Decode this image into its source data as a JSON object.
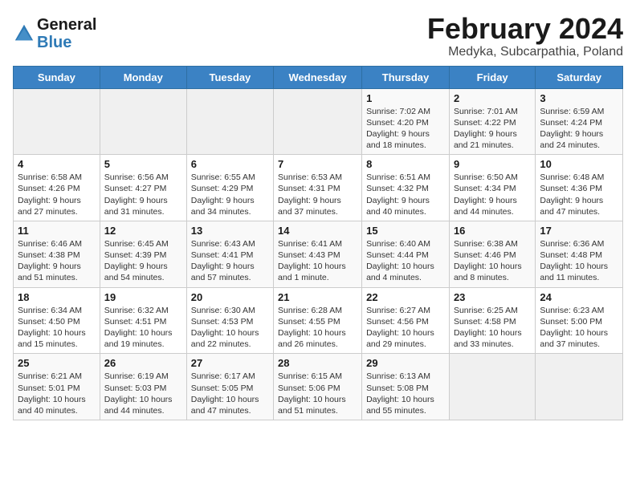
{
  "logo": {
    "text_general": "General",
    "text_blue": "Blue"
  },
  "title": "February 2024",
  "subtitle": "Medyka, Subcarpathia, Poland",
  "days_of_week": [
    "Sunday",
    "Monday",
    "Tuesday",
    "Wednesday",
    "Thursday",
    "Friday",
    "Saturday"
  ],
  "weeks": [
    [
      {
        "day": "",
        "info": ""
      },
      {
        "day": "",
        "info": ""
      },
      {
        "day": "",
        "info": ""
      },
      {
        "day": "",
        "info": ""
      },
      {
        "day": "1",
        "info": "Sunrise: 7:02 AM\nSunset: 4:20 PM\nDaylight: 9 hours\nand 18 minutes."
      },
      {
        "day": "2",
        "info": "Sunrise: 7:01 AM\nSunset: 4:22 PM\nDaylight: 9 hours\nand 21 minutes."
      },
      {
        "day": "3",
        "info": "Sunrise: 6:59 AM\nSunset: 4:24 PM\nDaylight: 9 hours\nand 24 minutes."
      }
    ],
    [
      {
        "day": "4",
        "info": "Sunrise: 6:58 AM\nSunset: 4:26 PM\nDaylight: 9 hours\nand 27 minutes."
      },
      {
        "day": "5",
        "info": "Sunrise: 6:56 AM\nSunset: 4:27 PM\nDaylight: 9 hours\nand 31 minutes."
      },
      {
        "day": "6",
        "info": "Sunrise: 6:55 AM\nSunset: 4:29 PM\nDaylight: 9 hours\nand 34 minutes."
      },
      {
        "day": "7",
        "info": "Sunrise: 6:53 AM\nSunset: 4:31 PM\nDaylight: 9 hours\nand 37 minutes."
      },
      {
        "day": "8",
        "info": "Sunrise: 6:51 AM\nSunset: 4:32 PM\nDaylight: 9 hours\nand 40 minutes."
      },
      {
        "day": "9",
        "info": "Sunrise: 6:50 AM\nSunset: 4:34 PM\nDaylight: 9 hours\nand 44 minutes."
      },
      {
        "day": "10",
        "info": "Sunrise: 6:48 AM\nSunset: 4:36 PM\nDaylight: 9 hours\nand 47 minutes."
      }
    ],
    [
      {
        "day": "11",
        "info": "Sunrise: 6:46 AM\nSunset: 4:38 PM\nDaylight: 9 hours\nand 51 minutes."
      },
      {
        "day": "12",
        "info": "Sunrise: 6:45 AM\nSunset: 4:39 PM\nDaylight: 9 hours\nand 54 minutes."
      },
      {
        "day": "13",
        "info": "Sunrise: 6:43 AM\nSunset: 4:41 PM\nDaylight: 9 hours\nand 57 minutes."
      },
      {
        "day": "14",
        "info": "Sunrise: 6:41 AM\nSunset: 4:43 PM\nDaylight: 10 hours\nand 1 minute."
      },
      {
        "day": "15",
        "info": "Sunrise: 6:40 AM\nSunset: 4:44 PM\nDaylight: 10 hours\nand 4 minutes."
      },
      {
        "day": "16",
        "info": "Sunrise: 6:38 AM\nSunset: 4:46 PM\nDaylight: 10 hours\nand 8 minutes."
      },
      {
        "day": "17",
        "info": "Sunrise: 6:36 AM\nSunset: 4:48 PM\nDaylight: 10 hours\nand 11 minutes."
      }
    ],
    [
      {
        "day": "18",
        "info": "Sunrise: 6:34 AM\nSunset: 4:50 PM\nDaylight: 10 hours\nand 15 minutes."
      },
      {
        "day": "19",
        "info": "Sunrise: 6:32 AM\nSunset: 4:51 PM\nDaylight: 10 hours\nand 19 minutes."
      },
      {
        "day": "20",
        "info": "Sunrise: 6:30 AM\nSunset: 4:53 PM\nDaylight: 10 hours\nand 22 minutes."
      },
      {
        "day": "21",
        "info": "Sunrise: 6:28 AM\nSunset: 4:55 PM\nDaylight: 10 hours\nand 26 minutes."
      },
      {
        "day": "22",
        "info": "Sunrise: 6:27 AM\nSunset: 4:56 PM\nDaylight: 10 hours\nand 29 minutes."
      },
      {
        "day": "23",
        "info": "Sunrise: 6:25 AM\nSunset: 4:58 PM\nDaylight: 10 hours\nand 33 minutes."
      },
      {
        "day": "24",
        "info": "Sunrise: 6:23 AM\nSunset: 5:00 PM\nDaylight: 10 hours\nand 37 minutes."
      }
    ],
    [
      {
        "day": "25",
        "info": "Sunrise: 6:21 AM\nSunset: 5:01 PM\nDaylight: 10 hours\nand 40 minutes."
      },
      {
        "day": "26",
        "info": "Sunrise: 6:19 AM\nSunset: 5:03 PM\nDaylight: 10 hours\nand 44 minutes."
      },
      {
        "day": "27",
        "info": "Sunrise: 6:17 AM\nSunset: 5:05 PM\nDaylight: 10 hours\nand 47 minutes."
      },
      {
        "day": "28",
        "info": "Sunrise: 6:15 AM\nSunset: 5:06 PM\nDaylight: 10 hours\nand 51 minutes."
      },
      {
        "day": "29",
        "info": "Sunrise: 6:13 AM\nSunset: 5:08 PM\nDaylight: 10 hours\nand 55 minutes."
      },
      {
        "day": "",
        "info": ""
      },
      {
        "day": "",
        "info": ""
      }
    ]
  ]
}
